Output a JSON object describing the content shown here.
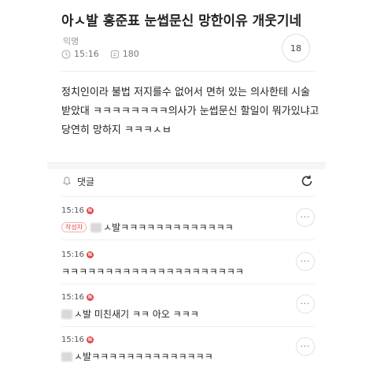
{
  "post": {
    "title": "아ㅅ발 홍준표 눈썹문신 망한이유 개웃기네",
    "author": "익명",
    "time": "15:16",
    "views": "180",
    "comment_count": "18",
    "body_lines": [
      "정치인이라 불법 저지를수 없어서 면허 있는 의사한테 시술",
      "받았대 ㅋㅋㅋㅋㅋㅋㅋㅋ의사가 눈썹문신 할일이 뭐가있냐고",
      "당연히 망하지 ㅋㅋㅋㅅㅂ"
    ]
  },
  "comments_section": {
    "label": "댓글"
  },
  "comments": [
    {
      "time": "15:16",
      "new_badge": "N",
      "author_badge": "작성자",
      "text": "ㅅ발ㅋㅋㅋㅋㅋㅋㅋㅋㅋㅋㅋㅋㅋ",
      "more": "···"
    },
    {
      "time": "15:16",
      "new_badge": "N",
      "text": "ㅋㅋㅋㅋㅋㅋㅋㅋㅋㅋㅋㅋㅋㅋㅋㅋㅋㅋㅋㅋㅋ",
      "more": "···"
    },
    {
      "time": "15:16",
      "new_badge": "N",
      "text": "ㅅ발 미친새기 ㅋㅋ 아오 ㅋㅋㅋ",
      "more": "···"
    },
    {
      "time": "15:16",
      "new_badge": "N",
      "text": "ㅅ발ㅋㅋㅋㅋㅋㅋㅋㅋㅋㅋㅋㅋㅋㅋ",
      "more": "···"
    }
  ],
  "icons": {
    "clock": "clock-icon",
    "views": "views-icon",
    "bell": "bell-icon",
    "refresh": "refresh-icon",
    "more": "more-icon"
  },
  "colors": {
    "new_badge": "#e54848",
    "muted": "#999999"
  }
}
